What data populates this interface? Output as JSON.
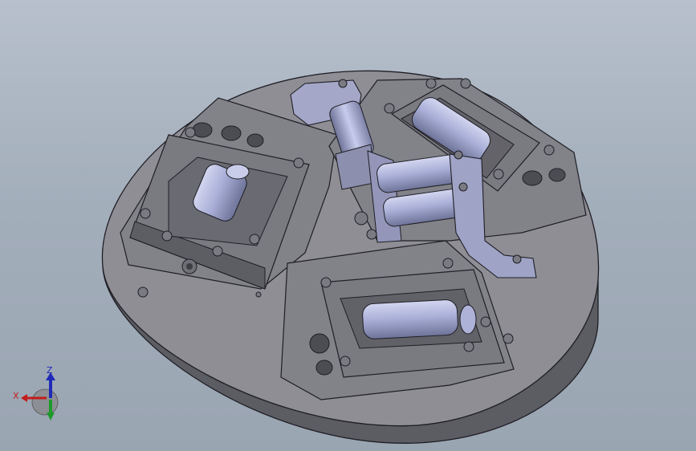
{
  "scene": {
    "description_colors": {
      "background_top": "#b7c0cc",
      "background_bottom": "#9aa5b2",
      "plate_top": "#8d8d93",
      "plate_side": "#5f5f66",
      "module": "#7f7f86",
      "cylinder": "#a9aed6",
      "outline": "#1e1e24"
    }
  },
  "triad": {
    "z_label": "Z",
    "x_label": "X",
    "z_color": "#1f2ab8",
    "x_color": "#c21c1c",
    "y_color": "#1c9a2a"
  }
}
